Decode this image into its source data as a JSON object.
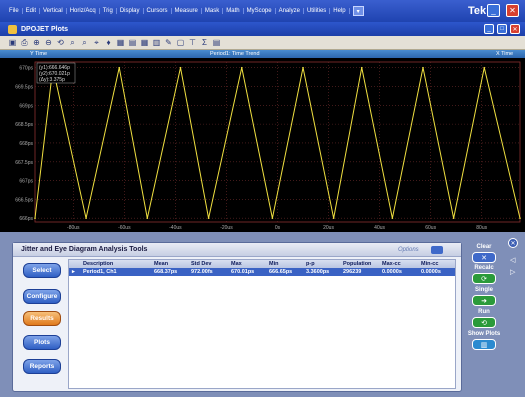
{
  "menu": [
    "File",
    "Edit",
    "Vertical",
    "Horiz/Acq",
    "Trig",
    "Display",
    "Cursors",
    "Measure",
    "Mask",
    "Math",
    "MyScope",
    "Analyze",
    "Utilities",
    "Help"
  ],
  "brand": "Tek",
  "window_title": "DPOJET Plots",
  "toolbar_icons": [
    "save-icon",
    "print-icon",
    "zoom-in-icon",
    "zoom-out-icon",
    "rotate-icon",
    "magnify-icon",
    "magnify-minus-icon",
    "cursor-icon",
    "marker-icon",
    "chart-icon",
    "table-icon",
    "grid-icon",
    "histogram-icon",
    "wrench-icon",
    "window-icon",
    "pin-icon",
    "sum-icon",
    "export-icon"
  ],
  "plot": {
    "left_label": "Y Time",
    "title": "Period1: Time Trend",
    "right_label": "X Time",
    "cursor_lines": [
      "(y1):666.646p",
      "(y2):670.021p",
      "(Δy):3.375p"
    ]
  },
  "chart_data": {
    "type": "line",
    "y_ticks": [
      "670ps",
      "669.5ps",
      "669ps",
      "668.5ps",
      "668ps",
      "667.5ps",
      "667ps",
      "666.5ps",
      "666ps"
    ],
    "x_ticks": [
      "-80us",
      "-60us",
      "-40us",
      "-20us",
      "0s",
      "20us",
      "40us",
      "60us",
      "80us"
    ],
    "xlim": [
      -95,
      95
    ],
    "ylim": [
      665.9,
      670.15
    ],
    "series": [
      {
        "color": "#f0e040",
        "x": [
          -95,
          -88,
          -75,
          -62,
          -51,
          -38,
          -27,
          -14,
          -2,
          10,
          22,
          33,
          45,
          57,
          69,
          81,
          95
        ],
        "y": [
          666.0,
          670.0,
          666.0,
          670.0,
          666.0,
          670.0,
          666.0,
          670.0,
          666.0,
          670.0,
          666.0,
          670.0,
          666.0,
          670.0,
          666.0,
          670.0,
          666.0
        ]
      }
    ]
  },
  "analysis": {
    "title": "Jitter and Eye Diagram Analysis Tools",
    "options_label": "Options",
    "side_buttons": [
      "Select",
      "Configure",
      "Results",
      "Plots",
      "Reports"
    ],
    "columns": [
      "Description",
      "Mean",
      "Std Dev",
      "Max",
      "Min",
      "p-p",
      "Population",
      "Max-cc",
      "Min-cc"
    ],
    "row": [
      "Period1, Ch1",
      "668.37ps",
      "972.00fs",
      "670.01ps",
      "666.65ps",
      "3.3600ps",
      "296239",
      "0.0000s",
      "0.0000s"
    ]
  },
  "right_controls": {
    "clear": "Clear",
    "recalc": "Recalc",
    "single": "Single",
    "run": "Run",
    "show_plots": "Show Plots"
  }
}
